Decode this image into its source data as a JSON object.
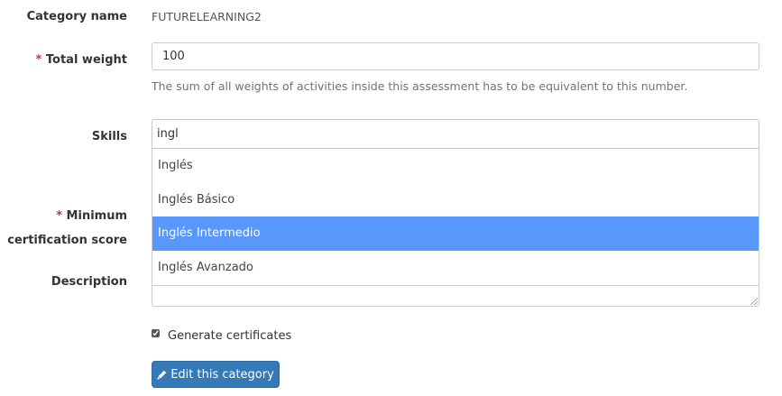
{
  "form": {
    "category_name": {
      "label": "Category name",
      "value": "FUTURELEARNING2"
    },
    "total_weight": {
      "required_mark": "*",
      "label": "Total weight",
      "value": "100",
      "help": "The sum of all weights of activities inside this assessment has to be equivalent to this number."
    },
    "skills": {
      "label": "Skills",
      "search_value": "ingl",
      "options": [
        "Inglés",
        "Inglés Básico",
        "Inglés Intermedio",
        "Inglés Avanzado"
      ],
      "highlighted": "Inglés Intermedio"
    },
    "minimum_certification_score": {
      "required_mark": "*",
      "label_line1": "Minimum",
      "label_line2": "certification score"
    },
    "description": {
      "label": "Description",
      "value": ""
    },
    "generate_certificates": {
      "label": "Generate certificates",
      "checked": true
    },
    "submit": {
      "label": "Edit this category",
      "icon": "pencil-icon"
    }
  },
  "colors": {
    "primary": "#337ab7",
    "highlight": "#5897fb",
    "required": "#a94442"
  }
}
